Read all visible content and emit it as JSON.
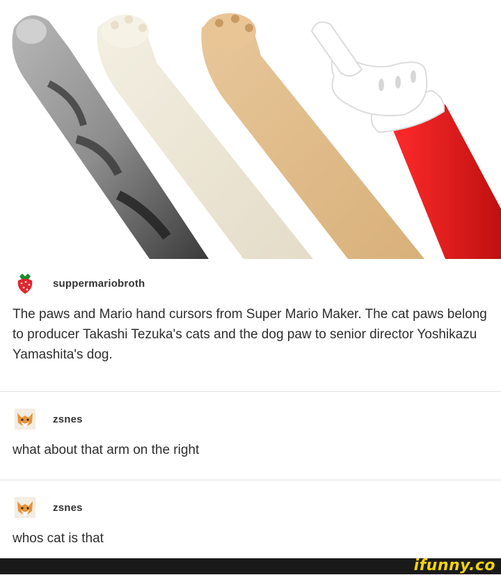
{
  "image": {
    "description_icon": "paws-and-cursor-hand-image"
  },
  "posts": [
    {
      "username": "suppermariobroth",
      "avatar_icon": "strawberry-avatar-icon",
      "text": "The paws and Mario hand cursors from Super Mario Maker. The cat paws belong to producer Takashi Tezuka's cats and the dog paw to senior director Yoshikazu Yamashita's dog."
    },
    {
      "username": "zsnes",
      "avatar_icon": "fox-avatar-icon",
      "text": "what about that arm on the right"
    },
    {
      "username": "zsnes",
      "avatar_icon": "fox-avatar-icon",
      "text": "whos cat is that"
    }
  ],
  "watermark": "ifunny.co",
  "colors": {
    "watermark": "#f5d500",
    "footer": "#1a1a1a",
    "mario_glove": "#ffffff",
    "mario_sleeve": "#e41e1e"
  }
}
